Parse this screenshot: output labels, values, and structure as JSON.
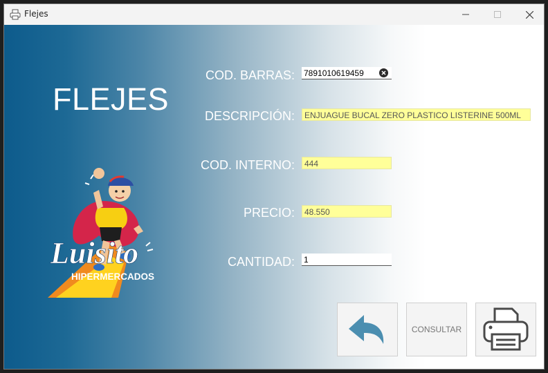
{
  "window": {
    "title": "Flejes"
  },
  "main": {
    "heading": "FLEJES",
    "logo": {
      "script_name": "Luisito",
      "tagline": "HIPERMERCADOS"
    },
    "form": {
      "barcode_label": "COD. BARRAS:",
      "barcode_value": "7891010619459",
      "description_label": "DESCRIPCIÓN:",
      "description_value": "ENJUAGUE BUCAL ZERO PLASTICO LISTERINE 500ML",
      "internal_code_label": "COD. INTERNO:",
      "internal_code_value": "444",
      "price_label": "PRECIO:",
      "price_value": "48.550",
      "quantity_label": "CANTIDAD:",
      "quantity_value": "1"
    },
    "buttons": {
      "back_icon": "back-arrow-icon",
      "query_label": "CONSULTAR",
      "print_icon": "printer-icon"
    }
  },
  "colors": {
    "field_highlight": "#ffff99",
    "gradient_start": "#0d5b8c",
    "button_bg": "#f4f4f4"
  }
}
